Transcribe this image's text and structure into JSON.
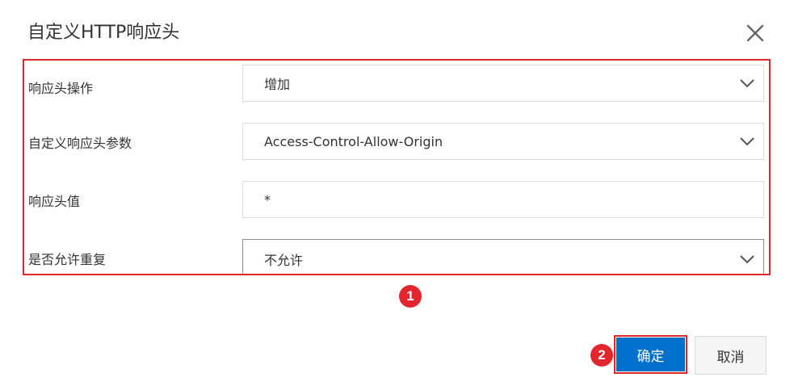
{
  "dialog": {
    "title": "自定义HTTP响应头",
    "close_icon": "close-icon"
  },
  "form": {
    "fields": [
      {
        "label": "响应头操作",
        "value": "增加",
        "type": "select"
      },
      {
        "label": "自定义响应头参数",
        "value": "Access-Control-Allow-Origin",
        "type": "select"
      },
      {
        "label": "响应头值",
        "value": "*",
        "type": "text"
      },
      {
        "label": "是否允许重复",
        "value": "不允许",
        "type": "select"
      }
    ]
  },
  "annotations": {
    "marker_1": "1",
    "marker_2": "2"
  },
  "buttons": {
    "confirm_label": "确定",
    "cancel_label": "取消"
  },
  "colors": {
    "primary": "#0070cc",
    "highlight": "#e3262d"
  }
}
